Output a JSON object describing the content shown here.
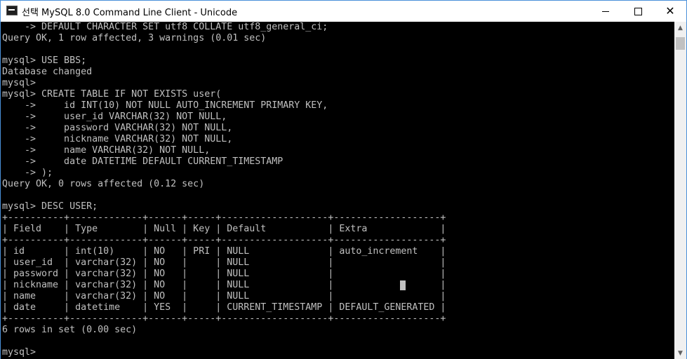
{
  "window": {
    "title": "선택 MySQL 8.0 Command Line Client - Unicode",
    "controls": {
      "minimize": "minimize",
      "maximize": "maximize",
      "close": "✕"
    }
  },
  "console": {
    "lines": [
      "    -> DEFAULT CHARACTER SET utf8 COLLATE utf8_general_ci;",
      "Query OK, 1 row affected, 3 warnings (0.01 sec)",
      "",
      "mysql> USE BBS;",
      "Database changed",
      "mysql>",
      "mysql> CREATE TABLE IF NOT EXISTS user(",
      "    ->     id INT(10) NOT NULL AUTO_INCREMENT PRIMARY KEY,",
      "    ->     user_id VARCHAR(32) NOT NULL,",
      "    ->     password VARCHAR(32) NOT NULL,",
      "    ->     nickname VARCHAR(32) NOT NULL,",
      "    ->     name VARCHAR(32) NOT NULL,",
      "    ->     date DATETIME DEFAULT CURRENT_TIMESTAMP",
      "    -> );",
      "Query OK, 0 rows affected (0.12 sec)",
      "",
      "mysql> DESC USER;",
      "+----------+-------------+------+-----+-------------------+-------------------+",
      "| Field    | Type        | Null | Key | Default           | Extra             |",
      "+----------+-------------+------+-----+-------------------+-------------------+",
      "| id       | int(10)     | NO   | PRI | NULL              | auto_increment    |",
      "| user_id  | varchar(32) | NO   |     | NULL              |                   |",
      "| password | varchar(32) | NO   |     | NULL              |                   |",
      "| nickname | varchar(32) | NO   |     | NULL              |                   |",
      "| name     | varchar(32) | NO   |     | NULL              |                   |",
      "| date     | datetime    | YES  |     | CURRENT_TIMESTAMP | DEFAULT_GENERATED |",
      "+----------+-------------+------+-----+-------------------+-------------------+",
      "6 rows in set (0.00 sec)",
      "",
      "mysql>"
    ]
  },
  "colors": {
    "console_bg": "#000000",
    "console_text": "#c0c0c0",
    "titlebar_bg": "#ffffff",
    "scrollbar_bg": "#f0f0f0"
  },
  "icons": {
    "app": "console-app-icon",
    "scroll_up": "▲",
    "scroll_down": "▼"
  }
}
